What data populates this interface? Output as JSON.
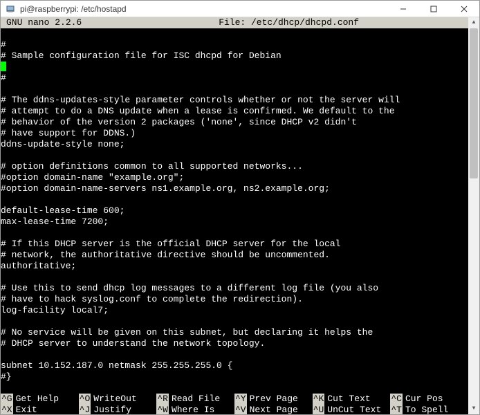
{
  "titlebar": {
    "text": "pi@raspberrypi: /etc/hostapd"
  },
  "header": {
    "app": "  GNU nano 2.2.6",
    "file_label": "File: /etc/dhcp/dhcpd.conf"
  },
  "lines": [
    "#",
    "# Sample configuration file for ISC dhcpd for Debian",
    "",
    "#",
    "",
    "# The ddns-updates-style parameter controls whether or not the server will",
    "# attempt to do a DNS update when a lease is confirmed. We default to the",
    "# behavior of the version 2 packages ('none', since DHCP v2 didn't",
    "# have support for DDNS.)",
    "ddns-update-style none;",
    "",
    "# option definitions common to all supported networks...",
    "#option domain-name \"example.org\";",
    "#option domain-name-servers ns1.example.org, ns2.example.org;",
    "",
    "default-lease-time 600;",
    "max-lease-time 7200;",
    "",
    "# If this DHCP server is the official DHCP server for the local",
    "# network, the authoritative directive should be uncommented.",
    "authoritative;",
    "",
    "# Use this to send dhcp log messages to a different log file (you also",
    "# have to hack syslog.conf to complete the redirection).",
    "log-facility local7;",
    "",
    "# No service will be given on this subnet, but declaring it helps the",
    "# DHCP server to understand the network topology.",
    "",
    "subnet 10.152.187.0 netmask 255.255.255.0 {",
    "#}"
  ],
  "cursor_line_index": 2,
  "shortcuts": [
    {
      "key": "^G",
      "label": "Get Help"
    },
    {
      "key": "^O",
      "label": "WriteOut"
    },
    {
      "key": "^R",
      "label": "Read File"
    },
    {
      "key": "^Y",
      "label": "Prev Page"
    },
    {
      "key": "^K",
      "label": "Cut Text"
    },
    {
      "key": "^C",
      "label": "Cur Pos"
    },
    {
      "key": "^X",
      "label": "Exit"
    },
    {
      "key": "^J",
      "label": "Justify"
    },
    {
      "key": "^W",
      "label": "Where Is"
    },
    {
      "key": "^V",
      "label": "Next Page"
    },
    {
      "key": "^U",
      "label": "UnCut Text"
    },
    {
      "key": "^T",
      "label": "To Spell"
    }
  ]
}
